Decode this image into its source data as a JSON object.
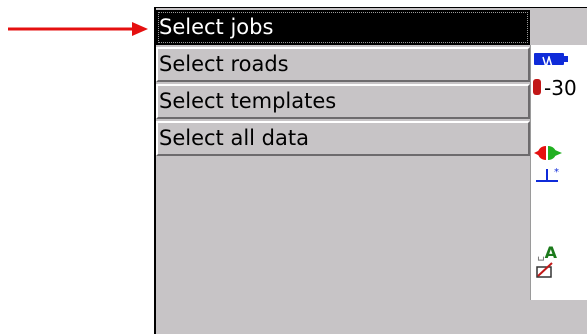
{
  "menu": {
    "items": [
      {
        "label": "Select jobs",
        "selected": true
      },
      {
        "label": "Select roads",
        "selected": false
      },
      {
        "label": "Select templates",
        "selected": false
      },
      {
        "label": "Select all data",
        "selected": false
      }
    ]
  },
  "status": {
    "temperature_text": "-30",
    "level_letter": "A",
    "icons": [
      "battery-icon",
      "temperature-icon",
      "prism-icon",
      "level-icon",
      "grade-icon",
      "pen-icon"
    ]
  },
  "colors": {
    "arrow": "#e51010",
    "menu_selected_bg": "#000000",
    "panel_bg": "#c7c4c6",
    "battery": "#0f2bd9"
  }
}
